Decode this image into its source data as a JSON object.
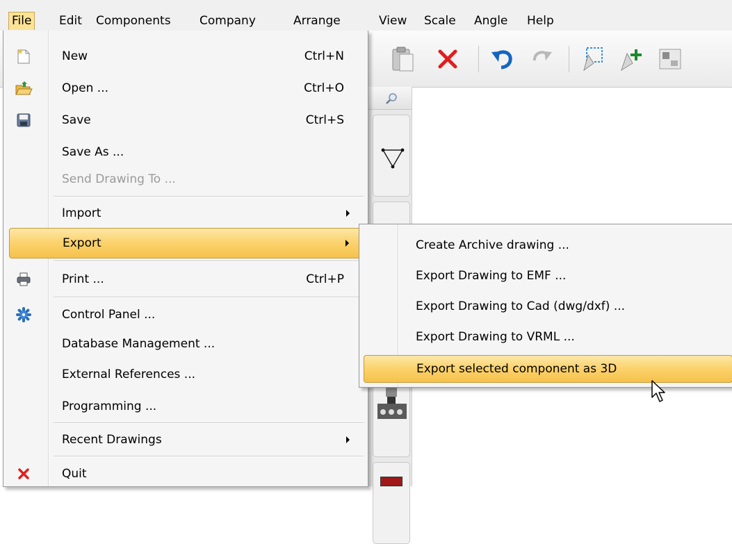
{
  "menubar": {
    "items": [
      "File",
      "Edit",
      "Components",
      "Company",
      "Arrange",
      "View",
      "Scale",
      "Angle",
      "Help"
    ],
    "active": "File"
  },
  "toolbar": {
    "icons": [
      "paste-icon",
      "delete-icon",
      "undo-icon",
      "redo-icon",
      "select-area-icon",
      "add-pointer-icon",
      "grid-icon"
    ],
    "accent_red": "#e01e1e",
    "accent_blue": "#1565c0"
  },
  "file_menu": {
    "items": [
      {
        "label": "New",
        "shortcut": "Ctrl+N",
        "icon": "new-document-icon"
      },
      {
        "label": "Open ...",
        "shortcut": "Ctrl+O",
        "icon": "open-folder-icon"
      },
      {
        "label": "Save",
        "shortcut": "Ctrl+S",
        "icon": "save-disk-icon"
      },
      {
        "label": "Save As ...",
        "shortcut": ""
      },
      {
        "label": "Send Drawing To ...",
        "shortcut": "",
        "disabled": true
      },
      {
        "label": "Import",
        "shortcut": "",
        "submenu": true
      },
      {
        "label": "Export",
        "shortcut": "",
        "submenu": true,
        "highlighted": true
      },
      {
        "label": "Print ...",
        "shortcut": "Ctrl+P",
        "icon": "printer-icon"
      },
      {
        "label": "Control Panel ...",
        "shortcut": "",
        "icon": "gear-icon"
      },
      {
        "label": "Database Management ...",
        "shortcut": ""
      },
      {
        "label": "External References ...",
        "shortcut": ""
      },
      {
        "label": "Programming ...",
        "shortcut": ""
      },
      {
        "label": "Recent Drawings",
        "shortcut": "",
        "submenu": true
      },
      {
        "label": "Quit",
        "shortcut": "",
        "icon": "close-icon"
      }
    ],
    "highlight_color": "#fbd26b"
  },
  "export_submenu": {
    "items": [
      {
        "label": "Create Archive drawing ..."
      },
      {
        "label": "Export Drawing to EMF ..."
      },
      {
        "label": "Export Drawing to Cad (dwg/dxf) ..."
      },
      {
        "label": "Export Drawing to VRML ..."
      },
      {
        "label": "Export selected component as 3D",
        "highlighted": true
      }
    ]
  }
}
